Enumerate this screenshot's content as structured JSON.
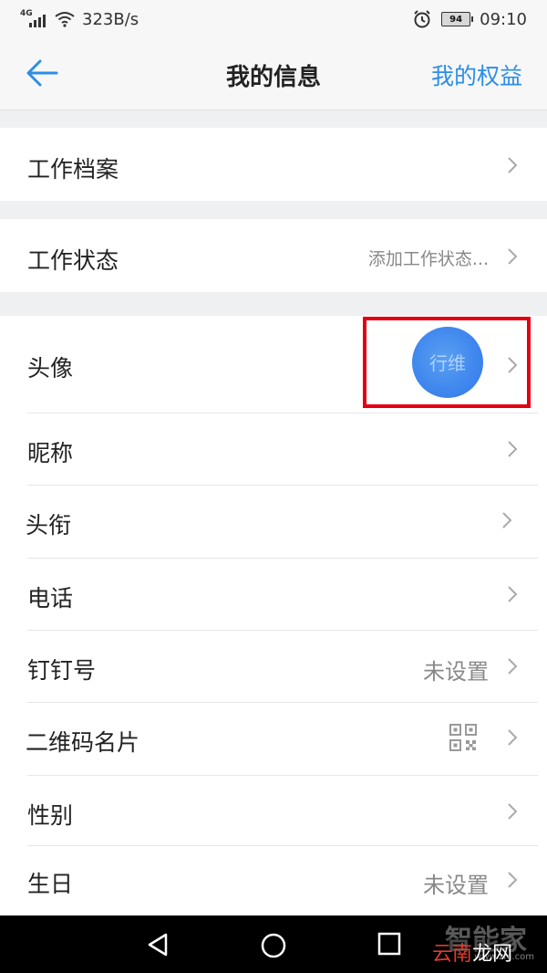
{
  "status_bar": {
    "network_type": "4G",
    "speed": "323B/s",
    "battery": "94",
    "time": "09:10"
  },
  "header": {
    "title": "我的信息",
    "right_action": "我的权益"
  },
  "rows": {
    "work_profile": {
      "label": "工作档案"
    },
    "work_status": {
      "label": "工作状态",
      "value": "添加工作状态..."
    },
    "avatar": {
      "label": "头像",
      "avatar_text": "行维"
    },
    "nickname": {
      "label": "昵称"
    },
    "title": {
      "label": "头衔"
    },
    "phone": {
      "label": "电话"
    },
    "dingtalk_id": {
      "label": "钉钉号",
      "value": "未设置"
    },
    "qr_card": {
      "label": "二维码名片"
    },
    "gender": {
      "label": "性别"
    },
    "birthday": {
      "label": "生日",
      "value": "未设置"
    }
  },
  "watermark": {
    "top": "智能家",
    "brand_red": "云南",
    "brand_white": "龙网",
    "sub": "www.znj.com"
  },
  "colors": {
    "accent": "#2c8ee6",
    "highlight": "#e3000f",
    "avatar": "#3f86ee"
  }
}
